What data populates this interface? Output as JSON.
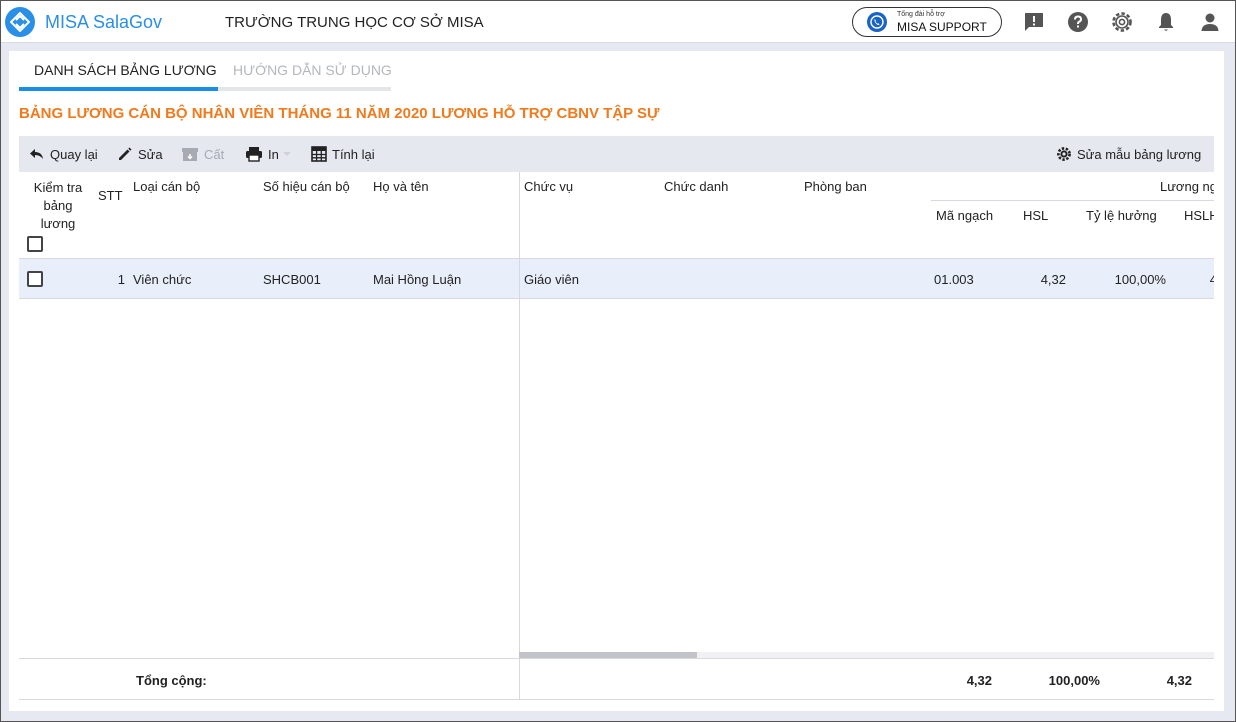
{
  "header": {
    "app_name": "MISA SalaGov",
    "org_name": "TRƯỜNG TRUNG HỌC CƠ SỞ MISA",
    "support_small": "Tổng đài hỗ trợ",
    "support_label": "MISA SUPPORT",
    "icons": [
      "feedback-icon",
      "help-icon",
      "settings-icon",
      "notification-icon",
      "user-icon"
    ]
  },
  "tabs": [
    {
      "label": "DANH SÁCH BẢNG LƯƠNG",
      "active": true
    },
    {
      "label": "HƯỚNG DẪN SỬ DỤNG",
      "active": false
    }
  ],
  "page_title": "BẢNG LƯƠNG CÁN BỘ NHÂN VIÊN THÁNG 11 NĂM 2020 LƯƠNG HỖ TRỢ CBNV TẬP SỰ",
  "toolbar": {
    "back": "Quay lại",
    "edit": "Sửa",
    "store": "Cất",
    "print": "In",
    "recalc": "Tính lại",
    "edit_template": "Sửa mẫu bảng lương"
  },
  "columns": {
    "check": "Kiểm tra bảng lương",
    "stt": "STT",
    "staff_type": "Loại cán bộ",
    "staff_code": "Số hiệu cán bộ",
    "full_name": "Họ và tên",
    "position": "Chức vụ",
    "title": "Chức danh",
    "department": "Phòng ban",
    "group_salary": "Lương ng",
    "grade_code": "Mã ngạch",
    "hsl": "HSL",
    "rate": "Tỷ lệ hưởng",
    "hslh": "HSLH"
  },
  "rows": [
    {
      "stt": "1",
      "staff_type": "Viên chức",
      "staff_code": "SHCB001",
      "full_name": "Mai Hồng Luận",
      "position": "Giáo viên",
      "title": "",
      "department": "",
      "grade_code": "01.003",
      "hsl": "4,32",
      "rate": "100,00%",
      "hslh": "4"
    }
  ],
  "totals": {
    "label": "Tổng cộng:",
    "hsl": "4,32",
    "rate": "100,00%",
    "hslh": "4,32"
  }
}
